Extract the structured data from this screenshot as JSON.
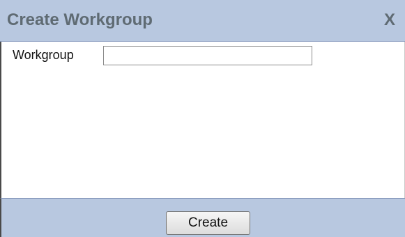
{
  "dialog": {
    "title": "Create Workgroup",
    "close_label": "X",
    "field": {
      "label": "Workgroup",
      "value": "",
      "placeholder": ""
    },
    "create_label": "Create"
  },
  "colors": {
    "header_bg": "#b8c8e0",
    "title_text": "#5f6b73"
  }
}
